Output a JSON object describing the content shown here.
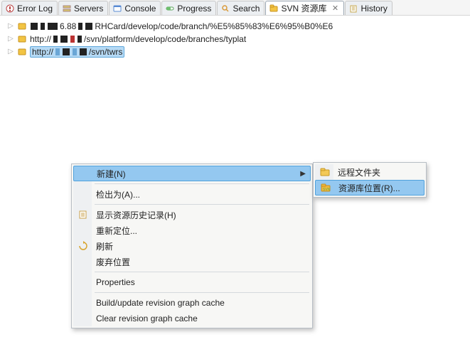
{
  "tabs": [
    {
      "label": "Error Log",
      "icon": "error-log"
    },
    {
      "label": "Servers",
      "icon": "servers"
    },
    {
      "label": "Console",
      "icon": "console"
    },
    {
      "label": "Progress",
      "icon": "progress"
    },
    {
      "label": "Search",
      "icon": "search"
    },
    {
      "label": "SVN 资源库",
      "icon": "svn-repo",
      "active": true,
      "closable": true
    },
    {
      "label": "History",
      "icon": "history"
    }
  ],
  "tree": {
    "items": [
      {
        "url_prefix": "",
        "url_obscured": true,
        "url_suffix": "6.88",
        "url_tail": "RHCard/develop/code/branch/%E5%85%83%E6%95%B0%E6"
      },
      {
        "url_prefix": "http://",
        "url_obscured": true,
        "url_suffix": "",
        "url_tail": "/svn/platform/develop/code/branches/typlat"
      },
      {
        "url_prefix": "http://",
        "url_obscured": true,
        "url_suffix": "",
        "url_tail": "/svn/twrs",
        "selected": true
      }
    ]
  },
  "context_menu": {
    "items": [
      {
        "label": "新建(N)",
        "icon": "",
        "submenu": true,
        "highlight": true
      },
      {
        "sep": true
      },
      {
        "label": "检出为(A)...",
        "icon": ""
      },
      {
        "sep": true
      },
      {
        "label": "显示资源历史记录(H)",
        "icon": "history-small"
      },
      {
        "label": "重新定位...",
        "icon": ""
      },
      {
        "label": "刷新",
        "icon": "refresh"
      },
      {
        "label": "废弃位置",
        "icon": ""
      },
      {
        "sep": true
      },
      {
        "label": "Properties",
        "icon": ""
      },
      {
        "sep": true
      },
      {
        "label": "Build/update revision graph cache",
        "icon": ""
      },
      {
        "label": "Clear revision graph cache",
        "icon": ""
      }
    ]
  },
  "sub_menu": {
    "items": [
      {
        "label": "远程文件夹",
        "icon": "folder"
      },
      {
        "label": "资源库位置(R)...",
        "icon": "svn-loc",
        "highlight": true
      }
    ]
  }
}
